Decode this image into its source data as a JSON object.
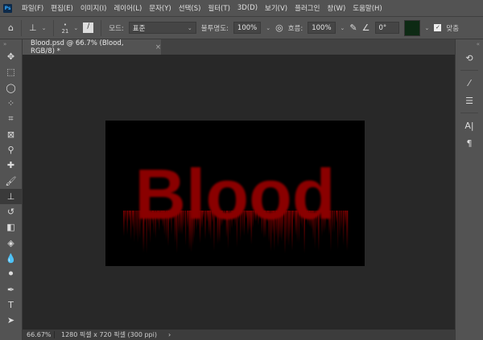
{
  "menu": {
    "items": [
      "파일(F)",
      "편집(E)",
      "이미지(I)",
      "레이어(L)",
      "문자(Y)",
      "선택(S)",
      "필터(T)",
      "3D(D)",
      "보기(V)",
      "플러그인",
      "창(W)",
      "도움말(H)"
    ]
  },
  "options": {
    "brush_size": "21",
    "mode_label": "모드:",
    "mode_value": "표준",
    "opacity_label": "불투명도:",
    "opacity_value": "100%",
    "flow_label": "흐름:",
    "flow_value": "100%",
    "angle_value": "0°",
    "aligned_label": "맞춤"
  },
  "tab": {
    "title": "Blood.psd @ 66.7% (Blood, RGB/8) *"
  },
  "document": {
    "text": "Blood",
    "text_color": "#8a0000",
    "background": "#000000"
  },
  "status": {
    "zoom": "66.67%",
    "size": "1280 픽셀 x 720 픽셀 (300 ppi)"
  }
}
